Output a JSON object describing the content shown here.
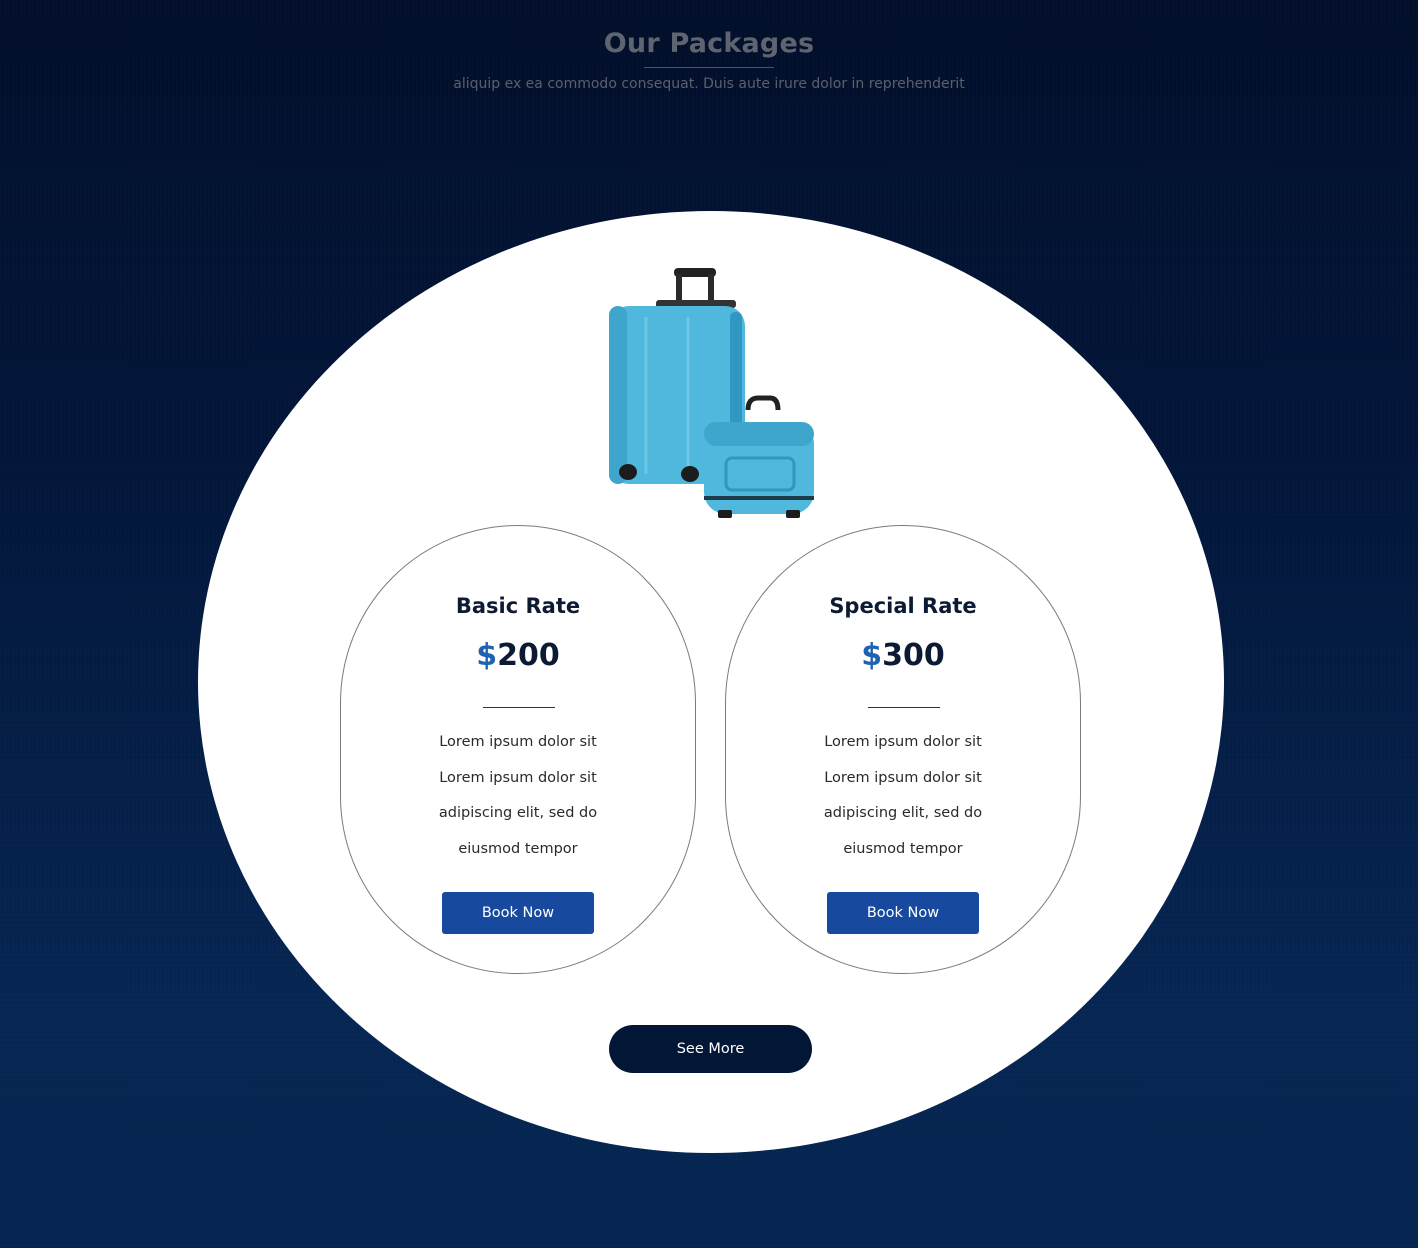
{
  "header": {
    "title": "Our Packages",
    "subtitle": "aliquip ex ea commodo consequat. Duis aute irure dolor in reprehenderit"
  },
  "image": {
    "icon": "luggage-image",
    "colors": {
      "luggage": "#4fb8dc",
      "luggage_shade": "#2f97c0",
      "handle": "#222222"
    }
  },
  "packages": [
    {
      "title": "Basic Rate",
      "currency": "$",
      "price": "200",
      "features": [
        "Lorem ipsum dolor sit",
        "Lorem ipsum dolor sit",
        "adipiscing elit, sed do",
        "eiusmod tempor"
      ],
      "button_label": "Book Now"
    },
    {
      "title": "Special Rate",
      "currency": "$",
      "price": "300",
      "features": [
        "Lorem ipsum dolor sit",
        "Lorem ipsum dolor sit",
        "adipiscing elit, sed do",
        "eiusmod tempor"
      ],
      "button_label": "Book Now"
    }
  ],
  "see_more_label": "See More",
  "colors": {
    "background": "#03173c",
    "accent": "#174a9f",
    "price_currency": "#1e63b0",
    "dark_button": "#021636"
  }
}
